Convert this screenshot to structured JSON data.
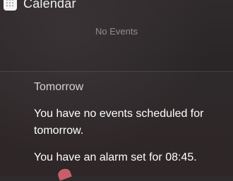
{
  "calendar": {
    "title": "Calendar",
    "today_status": "No Events"
  },
  "tomorrow": {
    "heading": "Tomorrow",
    "summary": "You have no events scheduled for tomorrow.",
    "alarm": "You have an alarm set for 08:45."
  },
  "colors": {
    "background": "#2b2628",
    "text_primary": "#ffffff",
    "text_muted": "#8c8688",
    "accent_glyph": "#e06a78"
  },
  "icons": {
    "calendar": "calendar-app-icon"
  }
}
